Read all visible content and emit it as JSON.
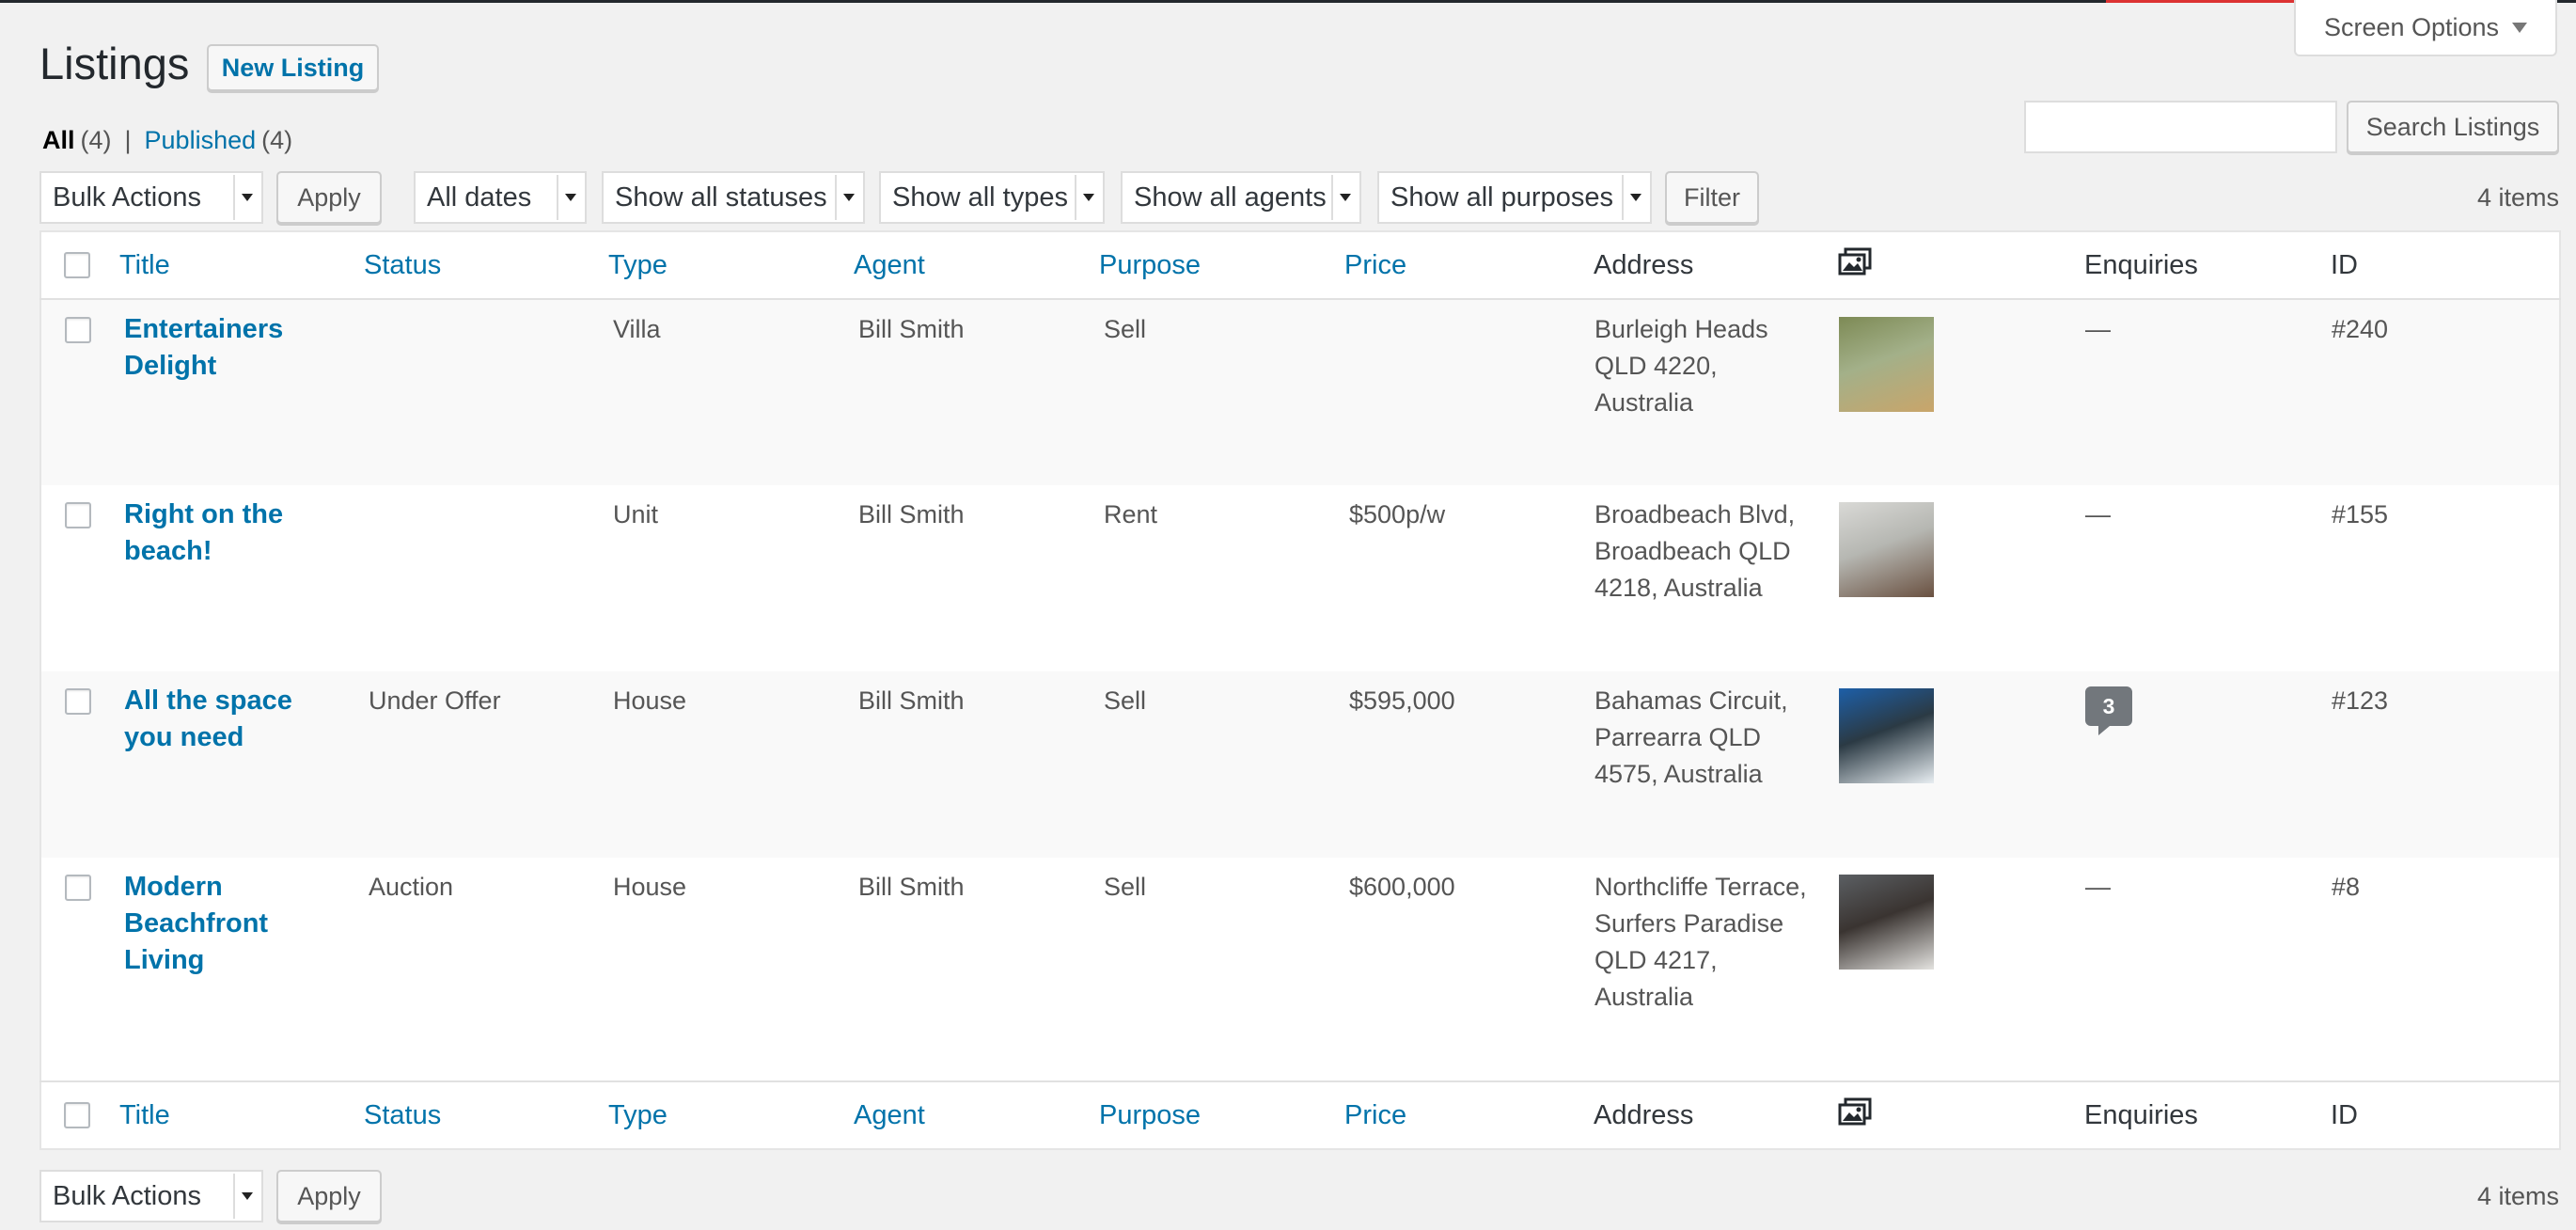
{
  "page": {
    "title": "Listings",
    "new_button": "New Listing",
    "screen_options": "Screen Options"
  },
  "filters_nav": {
    "all_label": "All",
    "all_count": "(4)",
    "separator": "|",
    "published_label": "Published",
    "published_count": "(4)"
  },
  "search": {
    "value": "",
    "button": "Search Listings"
  },
  "toolbar": {
    "bulk_actions": "Bulk Actions",
    "apply": "Apply",
    "dates": "All dates",
    "statuses": "Show all statuses",
    "types": "Show all types",
    "agents": "Show all agents",
    "purposes": "Show all purposes",
    "filter": "Filter",
    "items_count": "4 items"
  },
  "columns": {
    "title": "Title",
    "status": "Status",
    "type": "Type",
    "agent": "Agent",
    "purpose": "Purpose",
    "price": "Price",
    "address": "Address",
    "image_icon": "images-icon",
    "enquiries": "Enquiries",
    "id": "ID"
  },
  "rows": [
    {
      "title": "Entertainers Delight",
      "status": "",
      "type": "Villa",
      "agent": "Bill Smith",
      "purpose": "Sell",
      "price": "",
      "address": "Burleigh Heads QLD 4220, Australia",
      "enquiries": "—",
      "id": "#240",
      "thumb_colors": [
        "#7d8a55",
        "#c9a56a",
        "#a3b089"
      ]
    },
    {
      "title": "Right on the beach!",
      "status": "",
      "type": "Unit",
      "agent": "Bill Smith",
      "purpose": "Rent",
      "price": "$500p/w",
      "address": "Broadbeach Blvd, Broadbeach QLD 4218, Australia",
      "enquiries": "—",
      "id": "#155",
      "thumb_colors": [
        "#d9d9d6",
        "#6a5141",
        "#b6b7b2"
      ]
    },
    {
      "title": "All the space you need",
      "status": "Under Offer",
      "type": "House",
      "agent": "Bill Smith",
      "purpose": "Sell",
      "price": "$595,000",
      "address": "Bahamas Circuit, Parrearra QLD 4575, Australia",
      "enquiries": "3",
      "id": "#123",
      "thumb_colors": [
        "#1d5fa8",
        "#e8eef2",
        "#2b3a44"
      ]
    },
    {
      "title": "Modern Beachfront Living",
      "status": "Auction",
      "type": "House",
      "agent": "Bill Smith",
      "purpose": "Sell",
      "price": "$600,000",
      "address": "Northcliffe Terrace, Surfers Paradise QLD 4217, Australia",
      "enquiries": "—",
      "id": "#8",
      "thumb_colors": [
        "#5b5f63",
        "#e3e2df",
        "#3a3431"
      ]
    }
  ],
  "colors": {
    "link": "#0073aa",
    "background": "#f1f1f1",
    "badge": "#72777c",
    "alert": "#dc3232"
  }
}
